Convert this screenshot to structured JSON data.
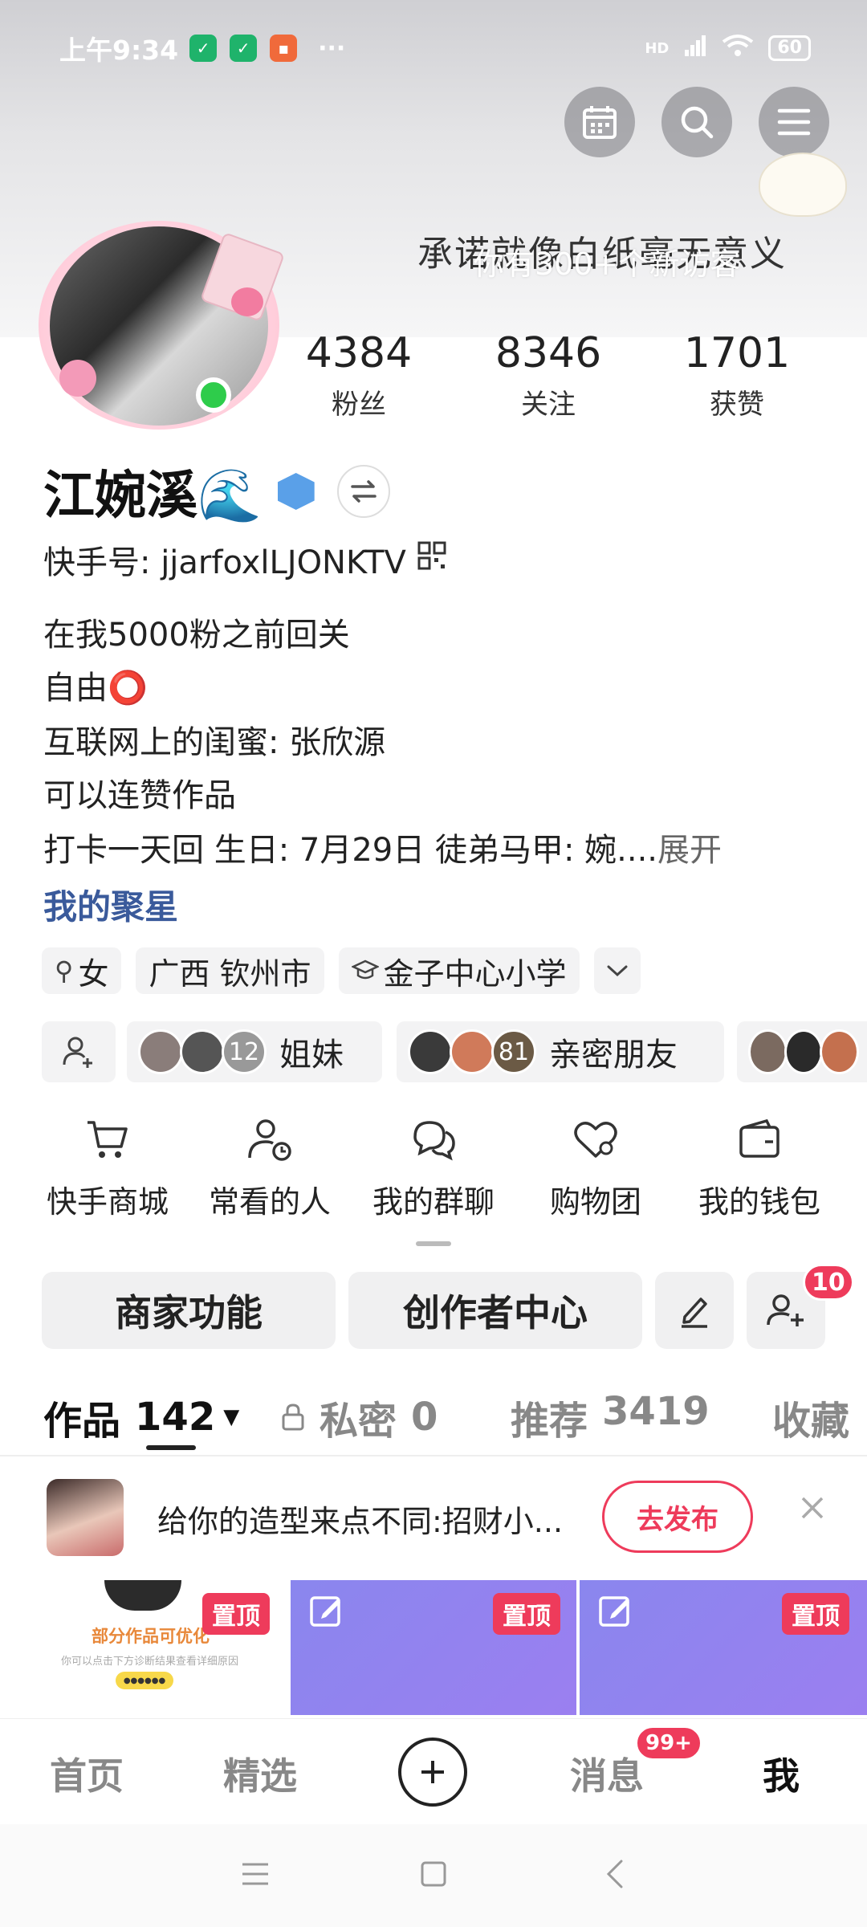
{
  "status_bar": {
    "time": "上午9:34",
    "dots": "···",
    "network": "HD",
    "battery": "60"
  },
  "header": {
    "banner_text": "承诺就像白纸毫无意义",
    "visitors_text": "你有300+个新访客"
  },
  "stats": [
    {
      "value": "4384",
      "label": "粉丝"
    },
    {
      "value": "8346",
      "label": "关注"
    },
    {
      "value": "1701",
      "label": "获赞"
    }
  ],
  "profile": {
    "name": "江婉溪🌊",
    "kuaishou_id": "快手号: jjarfoxlLJONKTV",
    "bio_lines": [
      "在我5000粉之前回关",
      "自由⭕",
      "互联网上的闺蜜: 张欣源",
      "可以连赞作品",
      "打卡一天回 生日: 7月29日 徒弟马甲: 婉...."
    ],
    "expand_label": "展开",
    "star_link": "我的聚星"
  },
  "tags": {
    "gender": "女",
    "location": "广西 钦州市",
    "school": "金子中心小学"
  },
  "groups": [
    {
      "count": "12",
      "label": "姐妹"
    },
    {
      "count": "81",
      "label": "亲密朋友"
    }
  ],
  "tools": [
    "快手商城",
    "常看的人",
    "我的群聊",
    "购物团",
    "我的钱包"
  ],
  "actions": {
    "merchant": "商家功能",
    "creator": "创作者中心",
    "friend_badge": "10"
  },
  "tabs": {
    "works": "作品",
    "works_count": "142",
    "private": "私密",
    "private_count": "0",
    "recommend": "推荐",
    "recommend_count": "3419",
    "favorites": "收藏"
  },
  "promo": {
    "text": "给你的造型来点不同:招财小...",
    "button": "去发布"
  },
  "grid": {
    "pin_label": "置顶",
    "first_title": "部分作品可优化",
    "first_sub": "你可以点击下方诊断结果查看详细原因",
    "first_dots": "●●●●●●"
  },
  "bottom_nav": {
    "home": "首页",
    "featured": "精选",
    "messages": "消息",
    "messages_badge": "99+",
    "me": "我"
  },
  "colors": {
    "accent": "#ee3b5b",
    "link": "#3a5a9b",
    "online": "#2ecc4b",
    "grid_purple": "#8d7ff0"
  }
}
